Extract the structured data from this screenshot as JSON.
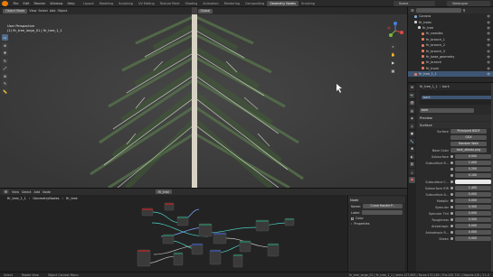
{
  "topbar": {
    "menus": [
      "File",
      "Edit",
      "Render",
      "Window",
      "Help"
    ],
    "tabs": [
      "Layout",
      "Modeling",
      "Sculpting",
      "UV Editing",
      "Texture Paint",
      "Shading",
      "Animation",
      "Rendering",
      "Compositing",
      "Geometry Nodes",
      "Scripting"
    ],
    "active_tab": "Geometry Nodes",
    "scene": "Scene",
    "view_layer": "ViewLayer"
  },
  "viewport": {
    "mode": "Object Mode",
    "menus": [
      "View",
      "Select",
      "Add",
      "Object"
    ],
    "orientation": "Global",
    "info_line1": "User Perspective",
    "info_line2": "(1) fir_tree_large_01 | fir_tree_1_1"
  },
  "node_editor": {
    "menus": [
      "View",
      "Select",
      "Add",
      "Node"
    ],
    "breadcrumb": [
      "fir_tree_1_1",
      "GeometryNodes",
      "fir_tree"
    ],
    "tree_name": "fir_tree",
    "panel": {
      "node_tab": "Node",
      "name_label": "Name:",
      "name_value": "Curve Handle P...",
      "label_label": "Label:",
      "color": "Color",
      "properties": "Properties"
    }
  },
  "outliner": {
    "rows": [
      {
        "label": "Camera",
        "depth": 1,
        "color": "#7aa8d8"
      },
      {
        "label": "fir_trees",
        "depth": 1,
        "color": "#d0d0d0"
      },
      {
        "label": "fir_tree",
        "depth": 2,
        "color": "#d0d0d0"
      },
      {
        "label": "fir_needles",
        "depth": 3,
        "color": "#e07a5f"
      },
      {
        "label": "fir_branch_1",
        "depth": 3,
        "color": "#e07a5f"
      },
      {
        "label": "fir_branch_2",
        "depth": 3,
        "color": "#e07a5f"
      },
      {
        "label": "fir_branch_3",
        "depth": 3,
        "color": "#e07a5f"
      },
      {
        "label": "fir_base_geometry",
        "depth": 3,
        "color": "#e07a5f"
      },
      {
        "label": "fir_branch",
        "depth": 3,
        "color": "#e07a5f"
      },
      {
        "label": "fir_trunk",
        "depth": 3,
        "color": "#e07a5f"
      },
      {
        "label": "fir_tree_1_1",
        "depth": 1,
        "color": "#e07a5f",
        "selected": true
      }
    ]
  },
  "properties": {
    "object": "fir_tree_1_1",
    "material": "bark",
    "slot": "bark",
    "preview": "Preview",
    "surface_section": "Surface",
    "surface_label": "Surface",
    "surface_value": "Principled BSDF",
    "distribution": "GGX",
    "subsurface_method": "Random Walk",
    "base_color_label": "Base Color",
    "base_color_value": "bark_albedo.png",
    "rows": [
      {
        "label": "Subsurface",
        "value": "0.000"
      },
      {
        "label": "Subsurface R...",
        "value": "1.000"
      },
      {
        "label": "",
        "value": "0.200"
      },
      {
        "label": "",
        "value": "0.100"
      },
      {
        "label": "Subsurface C...",
        "value": ""
      },
      {
        "label": "Subsurface IOR",
        "value": "1.400"
      },
      {
        "label": "Subsurface A...",
        "value": "0.000"
      },
      {
        "label": "Metallic",
        "value": "0.000"
      },
      {
        "label": "Specular",
        "value": "0.500"
      },
      {
        "label": "Specular Tint",
        "value": "0.000"
      },
      {
        "label": "Roughness",
        "value": "0.500"
      },
      {
        "label": "Anisotropic",
        "value": "0.000"
      },
      {
        "label": "Anisotropic R...",
        "value": "0.000"
      },
      {
        "label": "Sheen",
        "value": "0.000"
      }
    ]
  },
  "status": {
    "select": "Select",
    "rotate": "Rotate View",
    "context": "Object Context Menu",
    "stats": "fir_tree_large_01 | fir_tree_1_1 | Verts:127,683 | Faces:133,180 | Tris:245,720 | Objects:1/8 | 3.1.0"
  }
}
